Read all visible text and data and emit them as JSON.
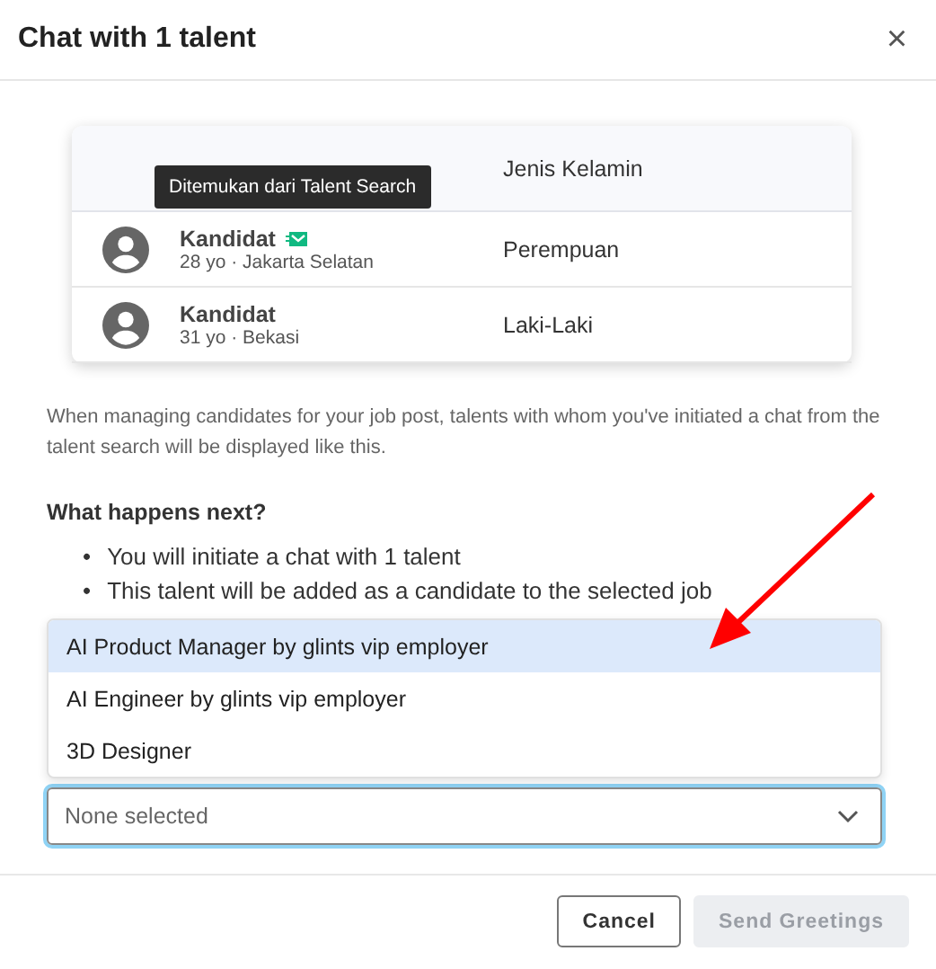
{
  "dialog": {
    "title": "Chat with 1 talent",
    "close": "×"
  },
  "preview_table": {
    "columns": [
      "Jenis Kelamin"
    ],
    "rows": [
      {
        "name": "Kandidat",
        "details": "28 yo · Jakarta Selatan",
        "gender": "Perempuan",
        "from_talent_search": true
      },
      {
        "name": "Kandidat",
        "details": "31 yo · Bekasi",
        "gender": "Laki-Laki",
        "from_talent_search": false
      }
    ],
    "tooltip": "Ditemukan dari Talent Search"
  },
  "description": "When managing candidates for your job post, talents with whom you've initiated a chat from the talent search will be displayed like this.",
  "next_steps": {
    "heading": "What happens next?",
    "items": [
      {
        "marker": "•",
        "text": "You will initiate a chat with 1 talent"
      },
      {
        "marker": "•",
        "text": "This talent will be added as a candidate to the selected job"
      }
    ]
  },
  "job_menu": {
    "options": [
      {
        "label": "AI Product Manager by glints vip employer",
        "selected": true
      },
      {
        "label": "AI Engineer by glints vip employer",
        "selected": false
      },
      {
        "label": "3D Designer",
        "selected": false
      }
    ]
  },
  "job_select": {
    "placeholder": "None selected"
  },
  "buttons": [
    {
      "label": "Cancel",
      "disabled": false
    },
    {
      "label": "Send Greetings",
      "disabled": true
    }
  ]
}
